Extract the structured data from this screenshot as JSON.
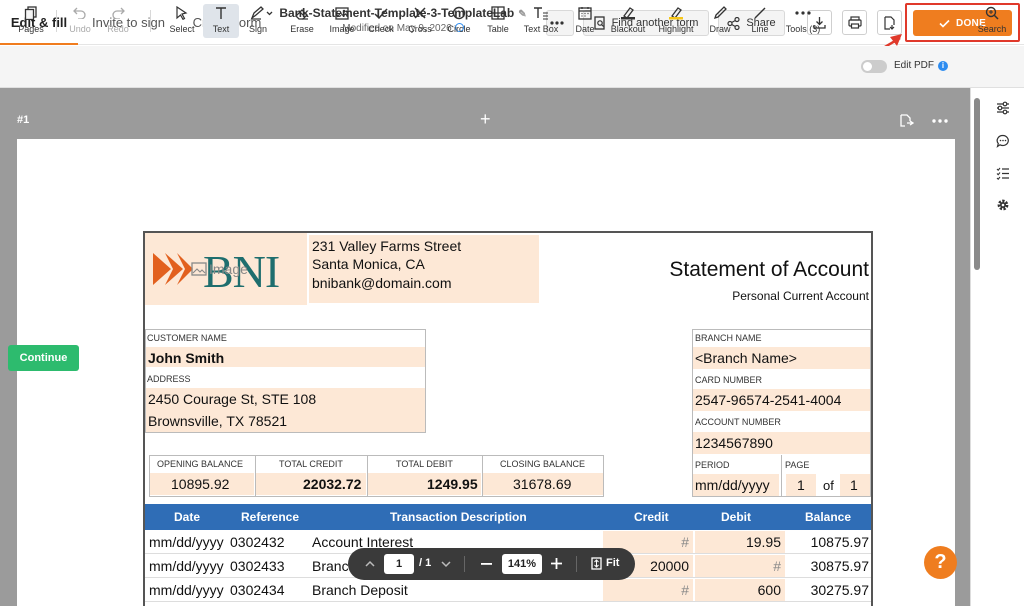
{
  "header": {
    "tabs": [
      {
        "label": "Edit & fill"
      },
      {
        "label": "Invite to sign"
      },
      {
        "label": "Create form"
      }
    ],
    "doc_name": "Bank-Statement-Template-3-TemplateLab",
    "modified": "Modified on May 9, 2026",
    "find_form": "Find another form",
    "share": "Share",
    "done": "DONE"
  },
  "toolbar": {
    "tools": [
      {
        "label": "Pages",
        "icon": "pages-icon"
      },
      {
        "label": "Undo",
        "icon": "undo-icon"
      },
      {
        "label": "Redo",
        "icon": "redo-icon"
      },
      {
        "label": "Select",
        "icon": "cursor-icon"
      },
      {
        "label": "Text",
        "icon": "text-icon"
      },
      {
        "label": "Sign",
        "icon": "sign-icon"
      },
      {
        "label": "Erase",
        "icon": "eraser-icon"
      },
      {
        "label": "Image",
        "icon": "image-icon"
      },
      {
        "label": "Check",
        "icon": "check-icon"
      },
      {
        "label": "Cross",
        "icon": "cross-icon"
      },
      {
        "label": "Circle",
        "icon": "circle-icon"
      },
      {
        "label": "Table",
        "icon": "table-icon"
      },
      {
        "label": "Text Box",
        "icon": "textbox-icon"
      },
      {
        "label": "Date",
        "icon": "calendar-icon"
      },
      {
        "label": "Blackout",
        "icon": "blackout-icon"
      },
      {
        "label": "Highlight",
        "icon": "highlight-icon"
      },
      {
        "label": "Draw",
        "icon": "draw-icon"
      },
      {
        "label": "Line",
        "icon": "line-icon"
      },
      {
        "label": "Tools (3)",
        "icon": "more-tools-icon"
      }
    ],
    "edit_pdf": "Edit PDF",
    "search": "Search"
  },
  "workspace": {
    "page_label": "#1",
    "continue": "Continue",
    "help": "?"
  },
  "pager": {
    "page": "1",
    "total": "/ 1",
    "zoom": "141%",
    "fit": "Fit"
  },
  "document": {
    "bank_logo": "BNI",
    "image_watermark": "Image",
    "bank_address1": "231 Valley Farms Street",
    "bank_address2": "Santa Monica, CA",
    "bank_email": "bnibank@domain.com",
    "title": "Statement of Account",
    "subtitle": "Personal Current Account",
    "customer_name_label": "CUSTOMER NAME",
    "customer_name": "John Smith",
    "address_label": "ADDRESS",
    "address1": "2450 Courage St, STE 108",
    "address2": "Brownsville, TX 78521",
    "branch_name_label": "BRANCH NAME",
    "branch_name": "<Branch Name>",
    "card_number_label": "CARD NUMBER",
    "card_number": "2547-96574-2541-4004",
    "account_number_label": "ACCOUNT NUMBER",
    "account_number": "1234567890",
    "period_label": "PERIOD",
    "period": "mm/dd/yyyy",
    "page_label": "PAGE",
    "page": "1",
    "of": "of",
    "page_total": "1",
    "summary_labels": [
      "OPENING BALANCE",
      "TOTAL CREDIT",
      "TOTAL DEBIT",
      "CLOSING BALANCE"
    ],
    "summary_values": [
      "10895.92",
      "22032.72",
      "1249.95",
      "31678.69"
    ],
    "columns": [
      "Date",
      "Reference",
      "Transaction Description",
      "Credit",
      "Debit",
      "Balance"
    ],
    "rows": [
      {
        "date": "mm/dd/yyyy",
        "ref": "0302432",
        "desc": "Account Interest",
        "credit": "#",
        "debit": "19.95",
        "balance": "10875.97"
      },
      {
        "date": "mm/dd/yyyy",
        "ref": "0302433",
        "desc": "Branch Deposit",
        "credit": "20000",
        "debit": "#",
        "balance": "30875.97"
      },
      {
        "date": "mm/dd/yyyy",
        "ref": "0302434",
        "desc": "Branch Deposit",
        "credit": "#",
        "debit": "600",
        "balance": "30275.97"
      }
    ]
  }
}
